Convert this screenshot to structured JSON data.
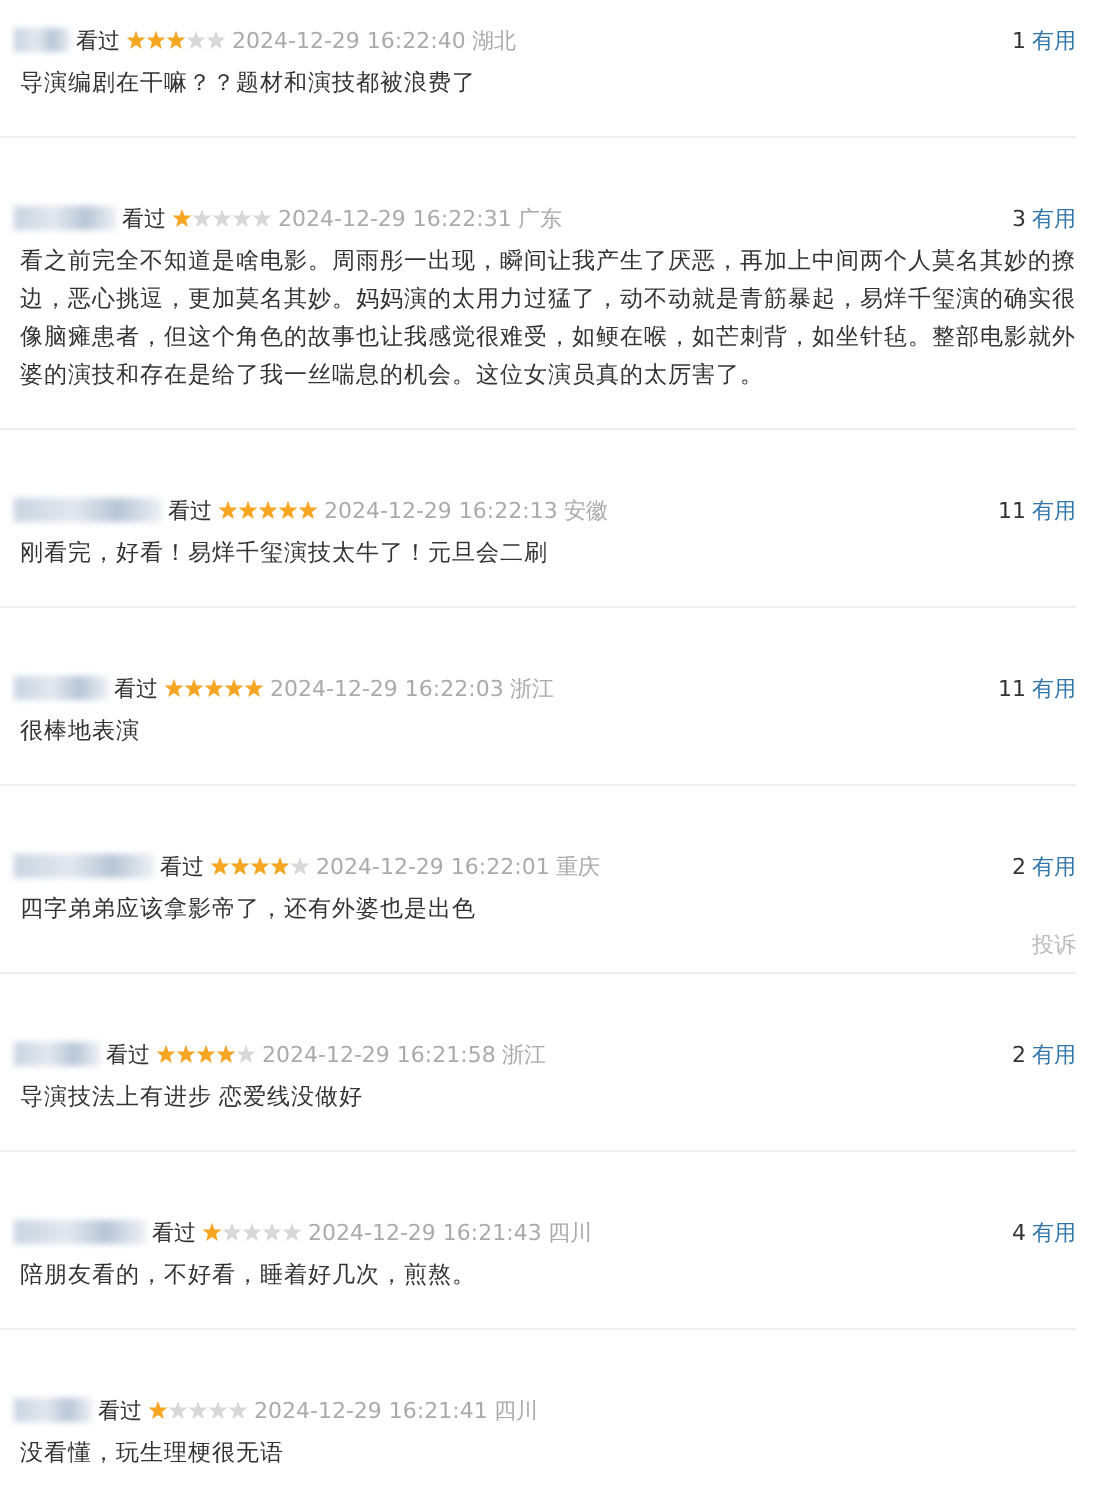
{
  "reviews": [
    {
      "watched": "看过",
      "stars": 3,
      "time": "2024-12-29 16:22:40",
      "location": "湖北",
      "useful_count": "1",
      "useful_label": "有用",
      "text": "导演编剧在干嘛？？题材和演技都被浪费了"
    },
    {
      "watched": "看过",
      "stars": 1,
      "time": "2024-12-29 16:22:31",
      "location": "广东",
      "useful_count": "3",
      "useful_label": "有用",
      "text": "看之前完全不知道是啥电影。周雨彤一出现，瞬间让我产生了厌恶，再加上中间两个人莫名其妙的撩边，恶心挑逗，更加莫名其妙。妈妈演的太用力过猛了，动不动就是青筋暴起，易烊千玺演的确实很像脑瘫患者，但这个角色的故事也让我感觉很难受，如鲠在喉，如芒刺背，如坐针毡。整部电影就外婆的演技和存在是给了我一丝喘息的机会。这位女演员真的太厉害了。"
    },
    {
      "watched": "看过",
      "stars": 5,
      "time": "2024-12-29 16:22:13",
      "location": "安徽",
      "useful_count": "11",
      "useful_label": "有用",
      "text": "刚看完，好看！易烊千玺演技太牛了！元旦会二刷"
    },
    {
      "watched": "看过",
      "stars": 5,
      "time": "2024-12-29 16:22:03",
      "location": "浙江",
      "useful_count": "11",
      "useful_label": "有用",
      "text": "很棒地表演"
    },
    {
      "watched": "看过",
      "stars": 4,
      "time": "2024-12-29 16:22:01",
      "location": "重庆",
      "useful_count": "2",
      "useful_label": "有用",
      "text": "四字弟弟应该拿影帝了，还有外婆也是出色",
      "report": "投诉"
    },
    {
      "watched": "看过",
      "stars": 4,
      "time": "2024-12-29 16:21:58",
      "location": "浙江",
      "useful_count": "2",
      "useful_label": "有用",
      "text": "导演技法上有进步 恋爱线没做好"
    },
    {
      "watched": "看过",
      "stars": 1,
      "time": "2024-12-29 16:21:43",
      "location": "四川",
      "useful_count": "4",
      "useful_label": "有用",
      "text": "陪朋友看的，不好看，睡着好几次，煎熬。"
    },
    {
      "watched": "看过",
      "stars": 1,
      "time": "2024-12-29 16:21:41",
      "location": "四川",
      "text": "没看懂，玩生理梗很无语"
    }
  ]
}
